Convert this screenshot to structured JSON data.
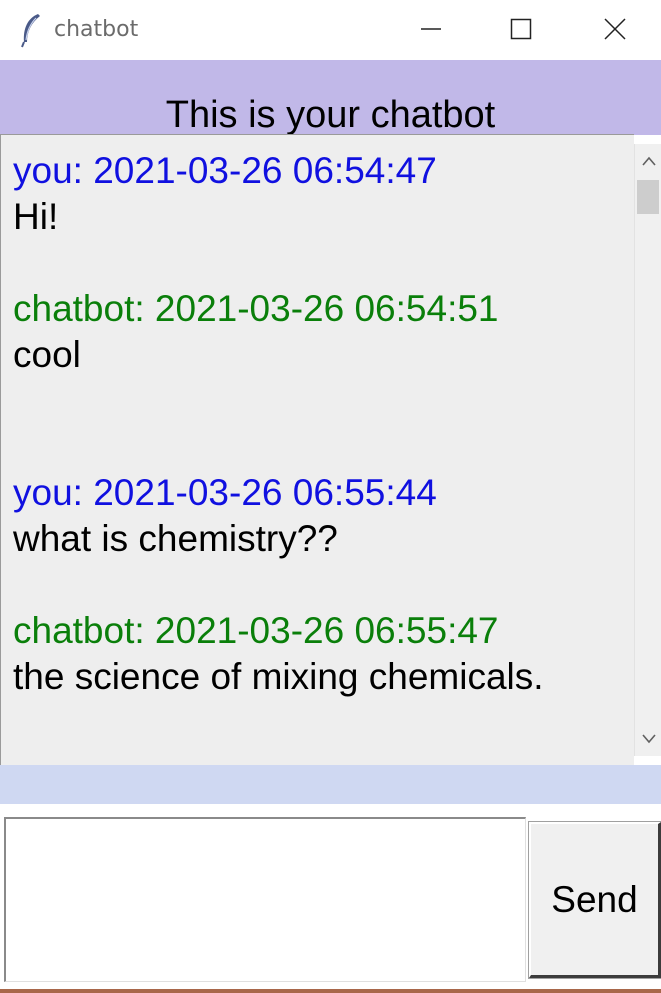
{
  "window": {
    "title": "chatbot",
    "icon": "feather-icon"
  },
  "header": {
    "heading": "This is your chatbot",
    "background": "#c1b8e8"
  },
  "chat": {
    "background": "#eeeeee",
    "colors": {
      "you": "#1010e0",
      "chatbot": "#0a7f0a"
    },
    "messages": [
      {
        "sender": "you",
        "header": "you: 2021-03-26 06:54:47",
        "text": "Hi!"
      },
      {
        "sender": "chatbot",
        "header": "chatbot: 2021-03-26 06:54:51",
        "text": "cool"
      },
      {
        "sender": "you",
        "header": "you: 2021-03-26 06:55:44",
        "text": "what is chemistry??"
      },
      {
        "sender": "chatbot",
        "header": "chatbot: 2021-03-26 06:55:47",
        "text": "the science of mixing chemicals."
      }
    ]
  },
  "composer": {
    "input_value": "",
    "send_label": "Send"
  }
}
